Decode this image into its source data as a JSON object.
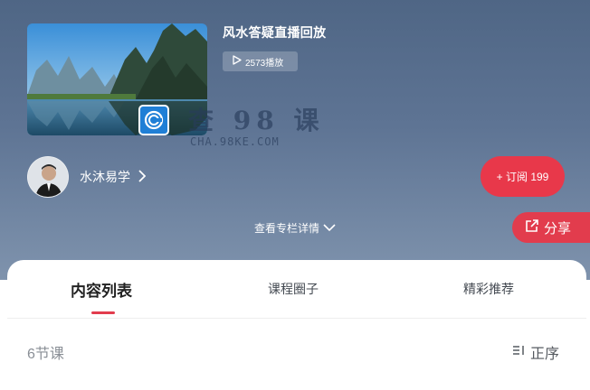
{
  "course": {
    "title": "风水答疑直播回放",
    "plays_label": "2573播放"
  },
  "watermark": {
    "main": "查 98 课",
    "sub": "CHA.98KE.COM"
  },
  "author": {
    "name": "水沐易学"
  },
  "actions": {
    "subscribe_label": "+ 订阅 199",
    "details_label": "查看专栏详情",
    "share_label": "分享"
  },
  "tabs": [
    {
      "label": "内容列表",
      "active": true
    },
    {
      "label": "课程圈子",
      "active": false
    },
    {
      "label": "精彩推荐",
      "active": false
    }
  ],
  "list": {
    "count_label": "6节课",
    "sort_label": "正序"
  },
  "colors": {
    "accent": "#e23c4d",
    "header": "#5e7494"
  }
}
